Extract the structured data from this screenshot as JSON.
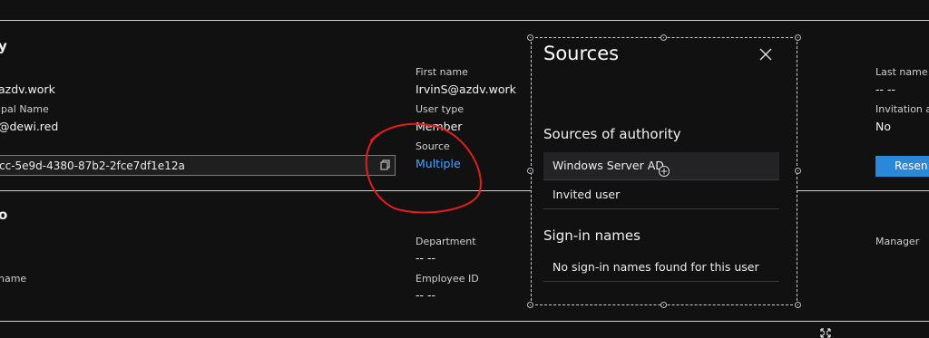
{
  "identity": {
    "title_fragment": "y",
    "email_fragment": "azdv.work",
    "upn_label_fragment": "ipal Name",
    "upn_value_fragment": "@dewi.red",
    "object_id_fragment": "cc-5e9d-4380-87b2-2fce7df1e12a",
    "first_name_label": "First name",
    "first_name_value": "IrvinS@azdv.work",
    "user_type_label": "User type",
    "user_type_value": "Member",
    "source_label": "Source",
    "source_value": "Multiple",
    "last_name_label": "Last name",
    "last_name_value": "-- --",
    "invitation_label_fragment": "Invitation a",
    "invitation_value": "No",
    "resend_label_fragment": "Resen"
  },
  "job_info": {
    "title_fragment": "o",
    "name_label_fragment": "name",
    "department_label": "Department",
    "department_value": "-- --",
    "employee_id_label": "Employee ID",
    "employee_id_value": "-- --",
    "manager_label": "Manager"
  },
  "sources_panel": {
    "title": "Sources",
    "authority_heading": "Sources of authority",
    "authority_items": [
      "Windows Server AD",
      "Invited user"
    ],
    "signin_heading": "Sign-in names",
    "signin_empty": "No sign-in names found for this user"
  },
  "colors": {
    "background": "#111112",
    "link": "#4da3ff",
    "primary_button": "#2b88d8",
    "annotation": "#e01e1e"
  }
}
